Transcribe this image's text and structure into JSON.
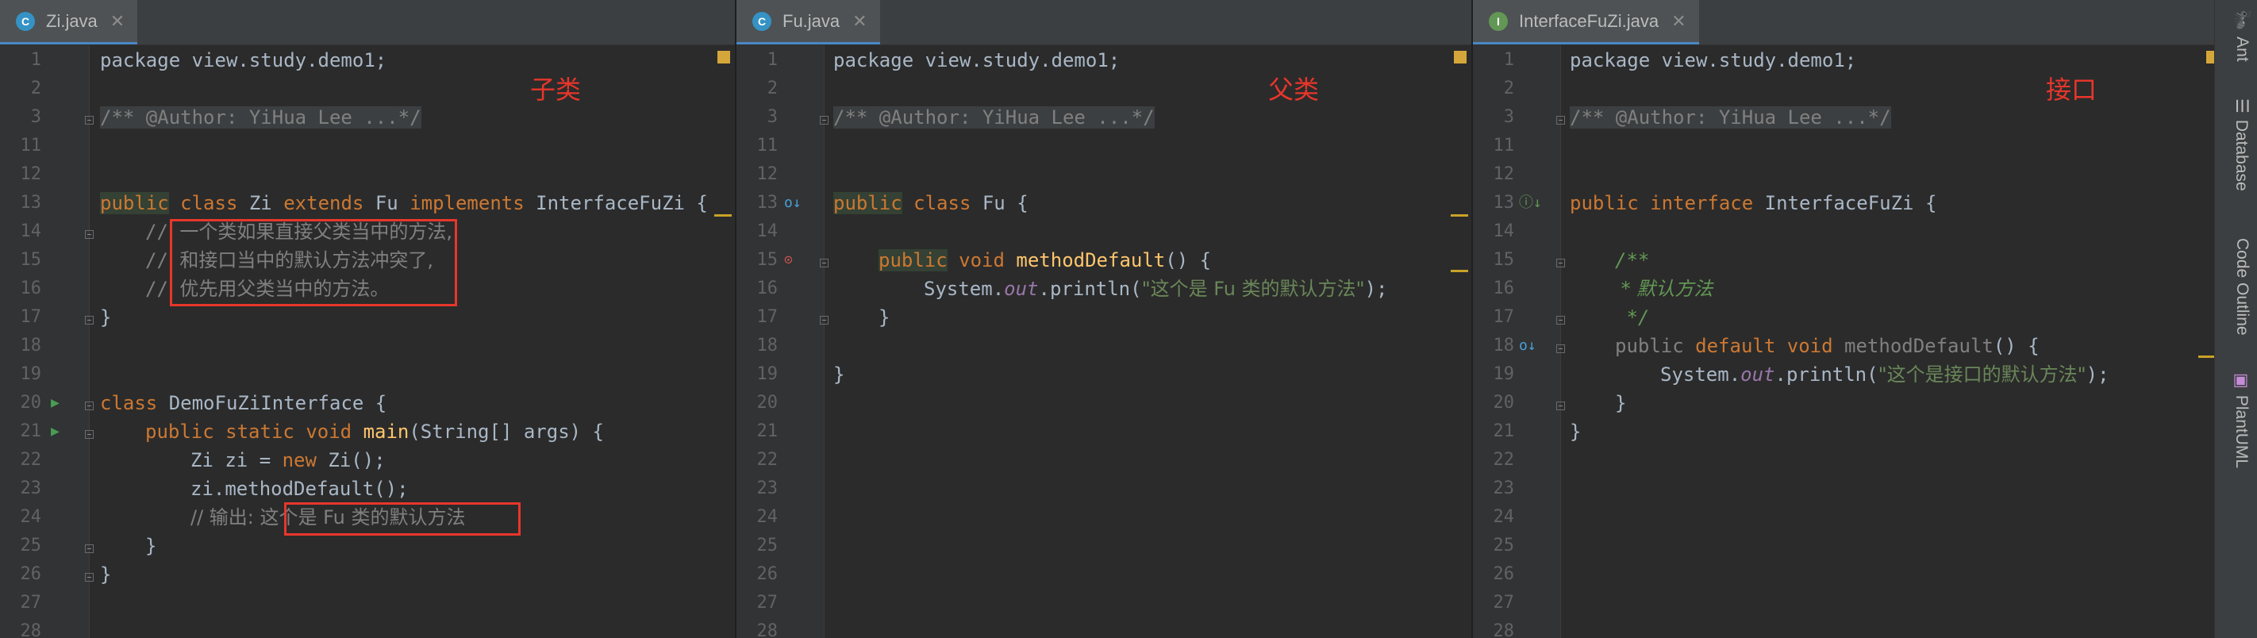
{
  "tabs": [
    {
      "name": "Zi.java",
      "icon_type": "class",
      "icon_letter": "C",
      "icon_color": "#3592c4"
    },
    {
      "name": "Fu.java",
      "icon_type": "class",
      "icon_letter": "C",
      "icon_color": "#3592c4"
    },
    {
      "name": "InterfaceFuZi.java",
      "icon_type": "interface",
      "icon_letter": "I",
      "icon_color": "#629755"
    }
  ],
  "annotations": {
    "zi": "子类",
    "fu": "父类",
    "iface": "接口"
  },
  "editor1": {
    "line_numbers": [
      "1",
      "2",
      "3",
      "11",
      "12",
      "13",
      "14",
      "15",
      "16",
      "17",
      "18",
      "19",
      "20",
      "21",
      "22",
      "23",
      "24",
      "25",
      "26",
      "27",
      "28"
    ],
    "package": "package view.study.demo1;",
    "author": "/** @Author: YiHua Lee ...*/",
    "class_decl": {
      "kw1": "public",
      "kw2": "class",
      "name": "Zi",
      "kw3": "extends",
      "parent": "Fu",
      "kw4": "implements",
      "iface": "InterfaceFuZi {"
    },
    "comment1": {
      "prefix": "// ",
      "text": "一个类如果直接父类当中的方法,"
    },
    "comment2": {
      "prefix": "// ",
      "text": "和接口当中的默认方法冲突了,"
    },
    "comment3": {
      "prefix": "// ",
      "text": "优先用父类当中的方法。"
    },
    "close_brace": "}",
    "class2": {
      "kw": "class",
      "name": "DemoFuZiInterface {"
    },
    "main": {
      "kw1": "public",
      "kw2": "static",
      "kw3": "void",
      "name": "main",
      "params": "(String[] args) {"
    },
    "new_line": {
      "a": "Zi zi = ",
      "kw": "new",
      "b": " Zi();"
    },
    "call_line": "zi.methodDefault();",
    "output_comment": {
      "prefix": "// 输出: ",
      "text": "这个是 Fu 类的默认方法"
    },
    "inner_close": "}",
    "outer_close": "}"
  },
  "editor2": {
    "line_numbers": [
      "1",
      "2",
      "3",
      "11",
      "12",
      "13",
      "14",
      "15",
      "16",
      "17",
      "18",
      "19",
      "20",
      "21",
      "22",
      "23",
      "24",
      "25",
      "26",
      "27",
      "28"
    ],
    "package": "package view.study.demo1;",
    "author": "/** @Author: YiHua Lee ...*/",
    "class_decl": {
      "kw1": "public",
      "kw2": "class",
      "name": "Fu {"
    },
    "method_decl": {
      "kw1": "public",
      "kw2": "void",
      "name": "methodDefault",
      "rest": "() {"
    },
    "println": {
      "a": "System.",
      "field": "out",
      "b": ".println(",
      "str": "\"这个是 Fu 类的默认方法\"",
      "c": ");"
    },
    "method_close": "}",
    "class_close": "}"
  },
  "editor3": {
    "line_numbers": [
      "1",
      "2",
      "3",
      "11",
      "12",
      "13",
      "14",
      "15",
      "16",
      "17",
      "18",
      "19",
      "20",
      "21",
      "22",
      "23",
      "24",
      "25",
      "26",
      "27",
      "28"
    ],
    "package": "package view.study.demo1;",
    "author": "/** @Author: YiHua Lee ...*/",
    "iface_decl": {
      "kw1": "public",
      "kw2": "interface",
      "name": "InterfaceFuZi {"
    },
    "javadoc1": "/**",
    "javadoc2": " * 默认方法",
    "javadoc3": " */",
    "method_decl": {
      "kw1": "public",
      "kw2": "default",
      "kw3": "void",
      "name": "methodDefault",
      "rest": "() {"
    },
    "println": {
      "a": "System.",
      "field": "out",
      "b": ".println(",
      "str": "\"这个是接口的默认方法\"",
      "c": ");"
    },
    "method_close": "}",
    "iface_close": "}"
  },
  "right_sidebar": [
    "Ant",
    "Database",
    "Code Outline",
    "PlantUML"
  ]
}
